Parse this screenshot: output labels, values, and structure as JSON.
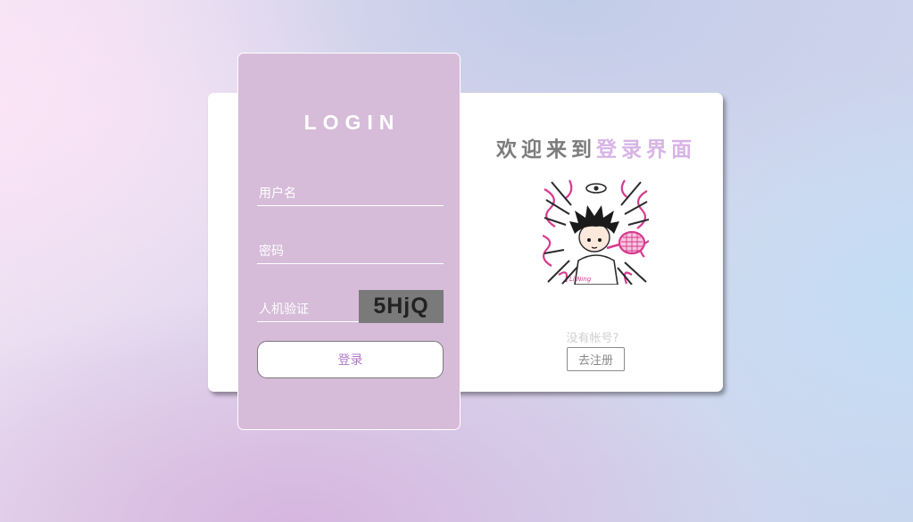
{
  "login": {
    "title": "LOGIN",
    "username_placeholder": "用户名",
    "password_placeholder": "密码",
    "captcha_placeholder": "人机验证",
    "captcha_code": "5HjQ",
    "submit_label": "登录"
  },
  "welcome": {
    "prefix": "欢迎来到",
    "highlight": "登录界面"
  },
  "avatar": {
    "icon": "anime-avatar-image",
    "signature": "Li Ning"
  },
  "register": {
    "prompt": "没有帐号?",
    "button_label": "去注册"
  },
  "colors": {
    "login_card": "#d6bcd9",
    "accent_text": "#d7b4e6",
    "button_text": "#b07ac8",
    "captcha_bg": "#7a7a7a"
  }
}
